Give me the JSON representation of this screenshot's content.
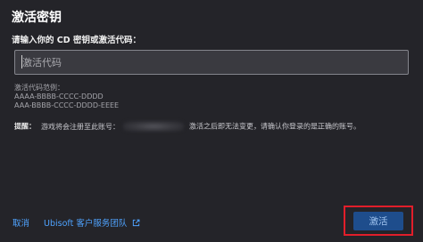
{
  "dialog": {
    "title": "激活密钥",
    "prompt": "请输入你的 CD 密钥或激活代码：",
    "input": {
      "placeholder": "激活代码",
      "value": ""
    },
    "examples": {
      "heading": "激活代码范例：",
      "items": [
        "AAAA-BBBB-CCCC-DDDD",
        "AAA-BBBB-CCCC-DDDD-EEEE"
      ]
    },
    "note": {
      "label": "提醒：",
      "part1": "游戏将会注册至此账号：",
      "part2": "激活之后即无法变更，请确认你登录的是正确的账号。"
    },
    "footer": {
      "cancel_label": "取消",
      "support_label": "Ubisoft 客户服务团队",
      "support_icon": "external-link-icon",
      "activate_label": "激活"
    },
    "colors": {
      "accent_link": "#4fa3ff",
      "primary_button": "#1e4d8c",
      "highlight_box": "#e11e2a",
      "background": "#242429"
    }
  }
}
